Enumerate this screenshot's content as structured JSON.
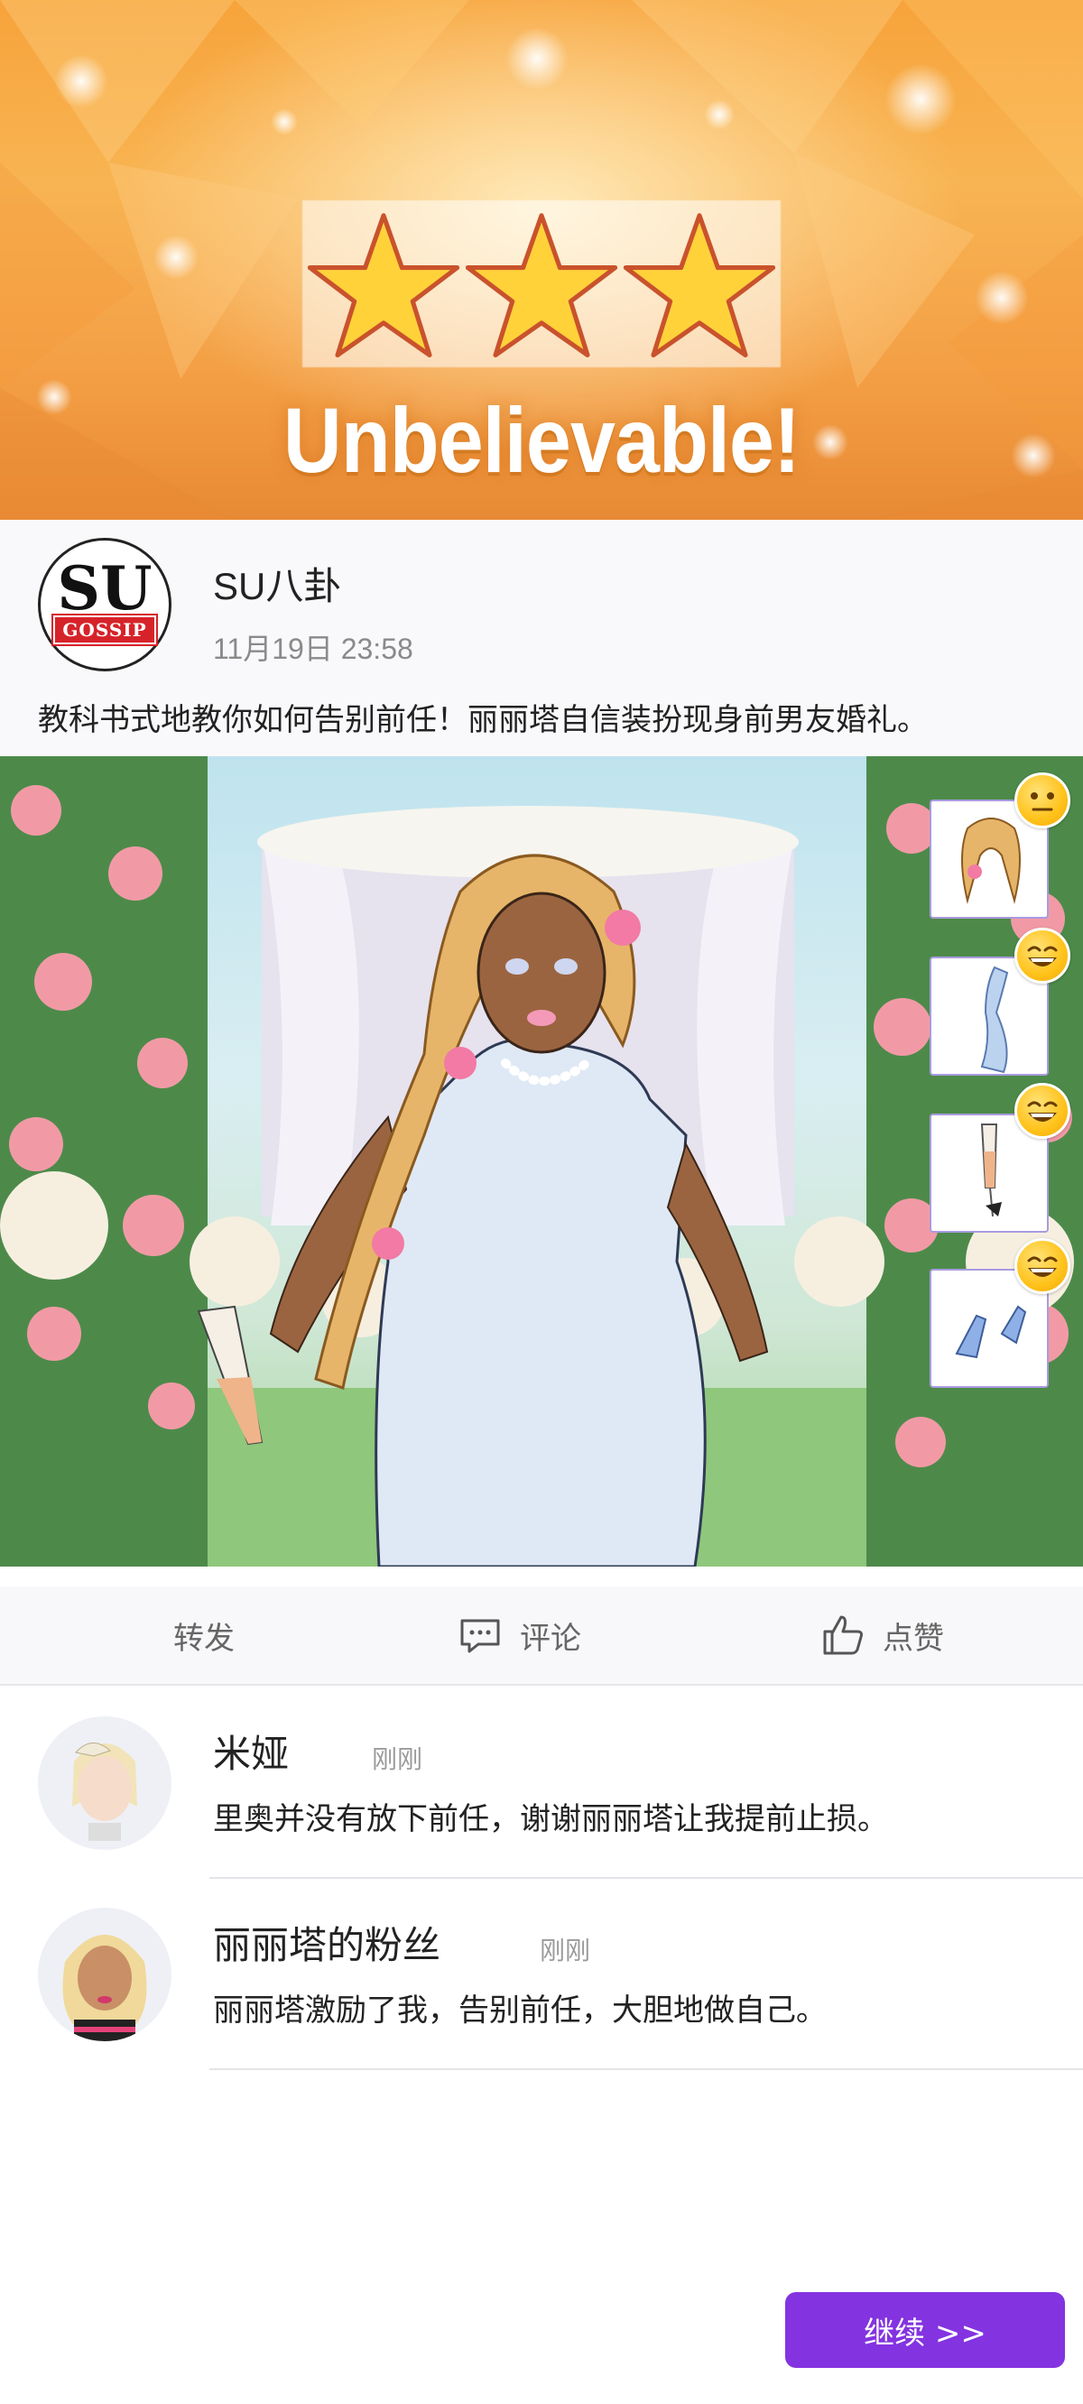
{
  "banner": {
    "headline": "Unbelievable!",
    "stars_earned": 3,
    "stars_total": 3
  },
  "post": {
    "author": "SU八卦",
    "logo_text": "SU",
    "logo_sub": "GOSSIP",
    "timestamp": "11月19日 23:58",
    "text": "教科书式地教你如何告别前任！丽丽塔自信装扮现身前男友婚礼。"
  },
  "outfit_items": [
    {
      "icon": "hair-icon",
      "reaction": "neutral-face-icon"
    },
    {
      "icon": "dress-icon",
      "reaction": "grin-face-icon"
    },
    {
      "icon": "champagne-glass-icon",
      "reaction": "grin-face-icon"
    },
    {
      "icon": "heels-icon",
      "reaction": "grin-face-icon"
    }
  ],
  "actions": {
    "share": "转发",
    "comment": "评论",
    "like": "点赞"
  },
  "comments": [
    {
      "name": "米娅",
      "time": "刚刚",
      "text": "里奥并没有放下前任，谢谢丽丽塔让我提前止损。"
    },
    {
      "name": "丽丽塔的粉丝",
      "time": "刚刚",
      "text": "丽丽塔激励了我，告别前任，大胆地做自己。"
    }
  ],
  "continue_label": "继续 >>",
  "colors": {
    "accent": "#8333e0",
    "banner": "#f8b452",
    "emoji": "#ffc21a"
  }
}
